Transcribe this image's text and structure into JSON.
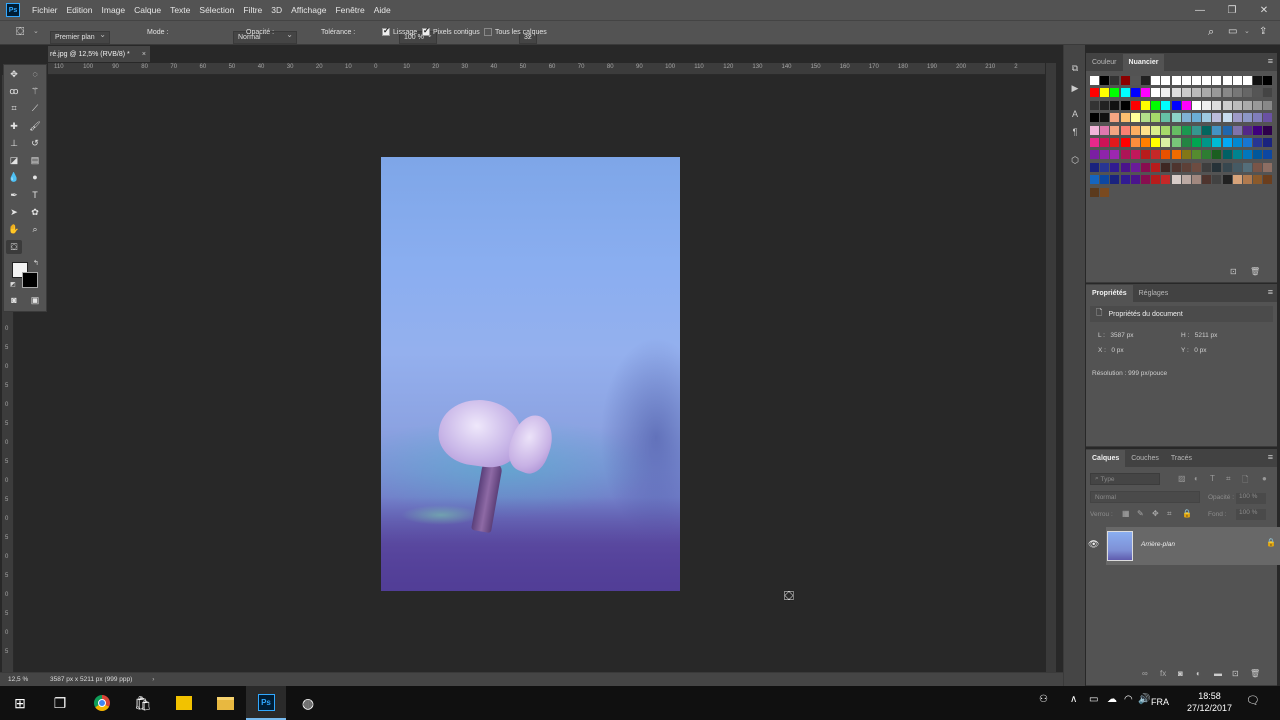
{
  "app": {
    "logo": "Ps"
  },
  "menu": [
    "Fichier",
    "Edition",
    "Image",
    "Calque",
    "Texte",
    "Sélection",
    "Filtre",
    "3D",
    "Affichage",
    "Fenêtre",
    "Aide"
  ],
  "window_controls": [
    "—",
    "❐",
    "✕"
  ],
  "options": {
    "fill_source": "Premier plan",
    "mode_label": "Mode :",
    "mode_value": "Normal",
    "opacity_label": "Opacité :",
    "opacity_value": "100 %",
    "tolerance_label": "Tolérance :",
    "tolerance_value": "32",
    "smoothing": "Lissage",
    "contiguous": "Pixels contigus",
    "all_layers": "Tous les calques"
  },
  "document": {
    "tab_title": "ré.jpg @ 12,5% (RVB/8) *",
    "close": "×"
  },
  "ruler": {
    "h": [
      "110",
      "100",
      "90",
      "80",
      "70",
      "60",
      "50",
      "40",
      "30",
      "20",
      "10",
      "0",
      "10",
      "20",
      "30",
      "40",
      "50",
      "60",
      "70",
      "80",
      "90",
      "100",
      "110",
      "120",
      "130",
      "140",
      "150",
      "160",
      "170",
      "180",
      "190",
      "200",
      "210",
      "2"
    ],
    "v": [
      "5",
      "0",
      "5",
      "0",
      "5",
      "0",
      "5",
      "0",
      "5",
      "0",
      "5",
      "0",
      "5",
      "0",
      "5",
      "0",
      "5",
      "0",
      "5",
      "0",
      "5",
      "0",
      "5",
      "0",
      "5",
      "0",
      "5",
      "0",
      "5",
      "0",
      "5"
    ]
  },
  "status": {
    "zoom": "12,5 %",
    "info": "3587 px x 5211 px (999 ppp)",
    "arrow": "›"
  },
  "swatch_panel": {
    "tab1": "Couleur",
    "tab2": "Nuancier"
  },
  "colors": {
    "row0": [
      "#ffffff",
      "#000000",
      "#333333",
      "#8b0000",
      "#555555",
      "#222222",
      "#ffffff",
      "#ffffff",
      "#ffffff",
      "#ffffff",
      "#ffffff",
      "#ffffff",
      "#ffffff",
      "#ffffff",
      "#ffffff",
      "#ffffff",
      "#111111",
      "#000000"
    ],
    "row1": [
      "#ff0000",
      "#ffff00",
      "#00ff00",
      "#00ffff",
      "#0000ff",
      "#ff00ff",
      "#ffffff",
      "#eeeeee",
      "#dddddd",
      "#cccccc",
      "#bbbbbb",
      "#aaaaaa",
      "#999999",
      "#888888",
      "#777777",
      "#666666",
      "#555555",
      "#444444"
    ],
    "row2": [
      "#333333",
      "#222222",
      "#111111",
      "#000000",
      "#ff0000",
      "#ffff00",
      "#00ff00",
      "#00ffff",
      "#0000ff",
      "#ff00ff",
      "#ffffff",
      "#eeeeee",
      "#dddddd",
      "#cccccc",
      "#bbbbbb",
      "#aaaaaa",
      "#999999",
      "#888888"
    ],
    "row3": [
      "#000000",
      "#111111",
      "#f4a582",
      "#fdbf6f",
      "#ffff99",
      "#b2df8a",
      "#a6d96a",
      "#66c2a5",
      "#8dd3c7",
      "#80b1d3",
      "#6baed6",
      "#9ecae1",
      "#bcbddc",
      "#c6dbef",
      "#9e9ac8",
      "#8c96c6",
      "#807dba",
      "#6a51a3"
    ],
    "row4": [
      "#f1b6da",
      "#de77ae",
      "#f4a582",
      "#fb8072",
      "#fdae61",
      "#fee08b",
      "#d9ef8b",
      "#a6d96a",
      "#66bd63",
      "#1a9850",
      "#35978f",
      "#01665e",
      "#4393c3",
      "#2166ac",
      "#8073ac",
      "#542788",
      "#3f007d",
      "#2d004b"
    ],
    "row5": [
      "#e7298a",
      "#ce1256",
      "#e31a1c",
      "#ff0000",
      "#fd8d3c",
      "#ff7f00",
      "#ffff00",
      "#d9f0a3",
      "#78c679",
      "#238443",
      "#00a651",
      "#009688",
      "#00bcd4",
      "#03a9f4",
      "#0288d1",
      "#1976d2",
      "#283593",
      "#1a237e"
    ],
    "row6": [
      "#7b1fa2",
      "#8e24aa",
      "#9c27b0",
      "#ad1457",
      "#c2185b",
      "#b71c1c",
      "#c62828",
      "#e65100",
      "#ef6c00",
      "#827717",
      "#558b2f",
      "#2e7d32",
      "#1b5e20",
      "#006064",
      "#00838f",
      "#0277bd",
      "#01579b",
      "#0d47a1"
    ],
    "row7": [
      "#1a237e",
      "#283593",
      "#311b92",
      "#4a148c",
      "#6a1b9a",
      "#880e4f",
      "#b71c1c",
      "#3e2723",
      "#4e342e",
      "#5d4037",
      "#6d4c41",
      "#3e3e3e",
      "#263238",
      "#37474f",
      "#455a64",
      "#546e7a",
      "#795548",
      "#8d6e63"
    ],
    "row8": [
      "#1565c0",
      "#0d47a1",
      "#1a237e",
      "#311b92",
      "#4a148c",
      "#880e4f",
      "#b71c1c",
      "#c62828",
      "#d7ccc8",
      "#bcaaa4",
      "#a1887f",
      "#4e342e",
      "#424242",
      "#212121",
      "#d7a37a",
      "#b07a4f",
      "#8b5a2b",
      "#6b3e1d"
    ],
    "row9": [
      "#5b3a1d",
      "#7a4a20"
    ]
  },
  "properties": {
    "tab1": "Propriétés",
    "tab2": "Réglages",
    "header": "Propriétés du document",
    "l_label": "L :",
    "l_value": "3587 px",
    "h_label": "H :",
    "h_value": "5211 px",
    "x_label": "X :",
    "x_value": "0 px",
    "y_label": "Y :",
    "y_value": "0 px",
    "resolution": "Résolution : 999 px/pouce"
  },
  "layers": {
    "tab1": "Calques",
    "tab2": "Couches",
    "tab3": "Tracés",
    "search_placeholder": "Type",
    "blend": "Normal",
    "opacity_label": "Opacité :",
    "opacity_value": "100 %",
    "lock_label": "Verrou :",
    "fill_label": "Fond :",
    "fill_value": "100 %",
    "layer_name": "Arrière-plan"
  },
  "taskbar": {
    "lang": "FRA",
    "time": "18:58",
    "date": "27/12/2017"
  }
}
